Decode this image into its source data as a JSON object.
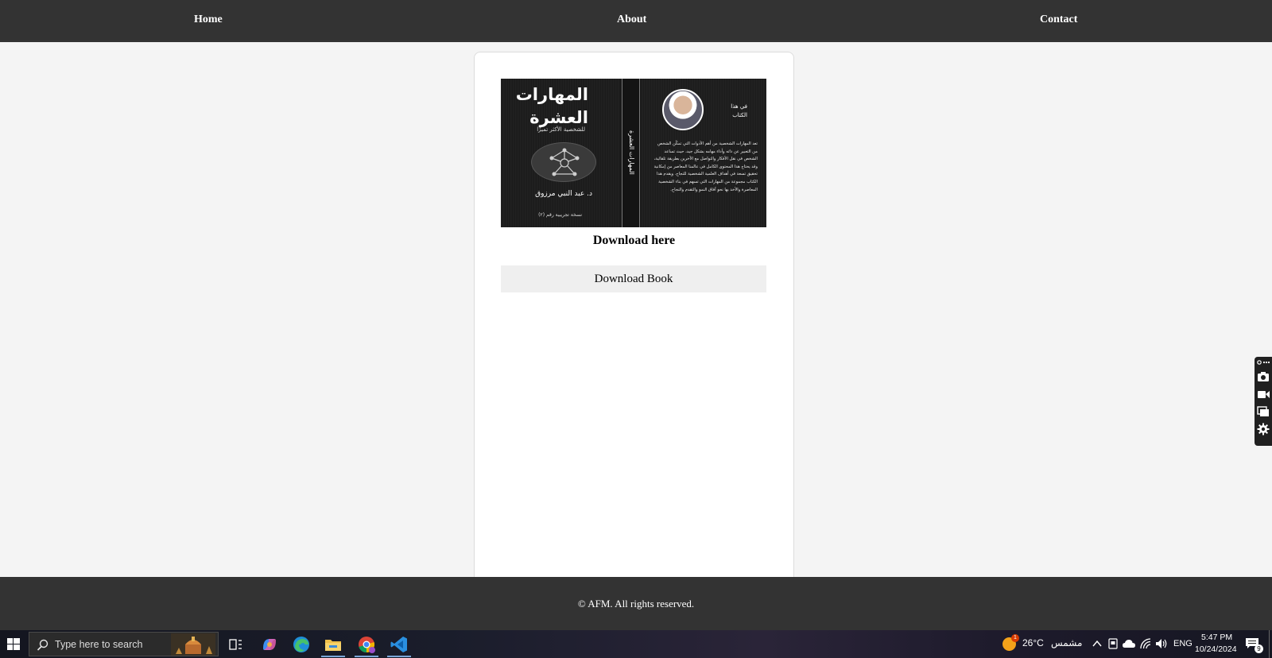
{
  "nav": {
    "home_label": "Home",
    "about_label": "About",
    "contact_label": "Contact"
  },
  "book": {
    "cover_title_line1": "المهارات",
    "cover_title_line2": "العشرة",
    "cover_subtitle": "للشخصية الأكثر تميزًا",
    "cover_author": "د. عبد النبي مرزوق",
    "cover_edition": "نسخة تجريبية رقم (٢)",
    "spine_text": "المهارات العشرة",
    "back_heading_line1": "في هذا",
    "back_heading_line2": "الكتاب",
    "back_body": "تعد المهارات الشخصية من أهم الأدوات التي تمكّن الشخص من التعبير عن ذاته وأداء مهامه بشكل جيد، حيث تساعد الشخص في نقل الأفكار والتواصل مع الآخرين بطريقة تلقائية، وقد يحتاج هذا المحتوى الكامل في عالمنا المعاصر من إمكانية تحقيق تسعة في أهداف العلمية الشخصية للنجاح. ويقدم هذا الكتاب مجموعة من المهارات التي تسهم في بناء الشخصية المعاصرة والأخذ بها نحو آفاق النمو والتقدم والنجاح.",
    "download_label": "Download here",
    "download_button": "Download Book"
  },
  "footer": {
    "text": "© AFM. All rights reserved."
  },
  "side_toolbar": {
    "icons": [
      "link-dots-icon",
      "camera-icon",
      "video-icon",
      "windows-icon",
      "gear-icon"
    ]
  },
  "taskbar": {
    "search_placeholder": "Type here to search",
    "apps": [
      "task-view-icon",
      "copilot-icon",
      "edge-icon",
      "file-explorer-icon",
      "chrome-icon",
      "vscode-icon"
    ],
    "weather_temp": "26°C",
    "weather_desc": "مشمس",
    "weather_badge": "1",
    "language": "ENG",
    "time": "5:47 PM",
    "date": "10/24/2024",
    "notification_count": "9"
  },
  "colors": {
    "nav_bg": "#333333",
    "page_bg": "#f4f4f4",
    "card_bg": "#ffffff",
    "button_bg": "#efefef",
    "footer_bg": "#333333"
  }
}
